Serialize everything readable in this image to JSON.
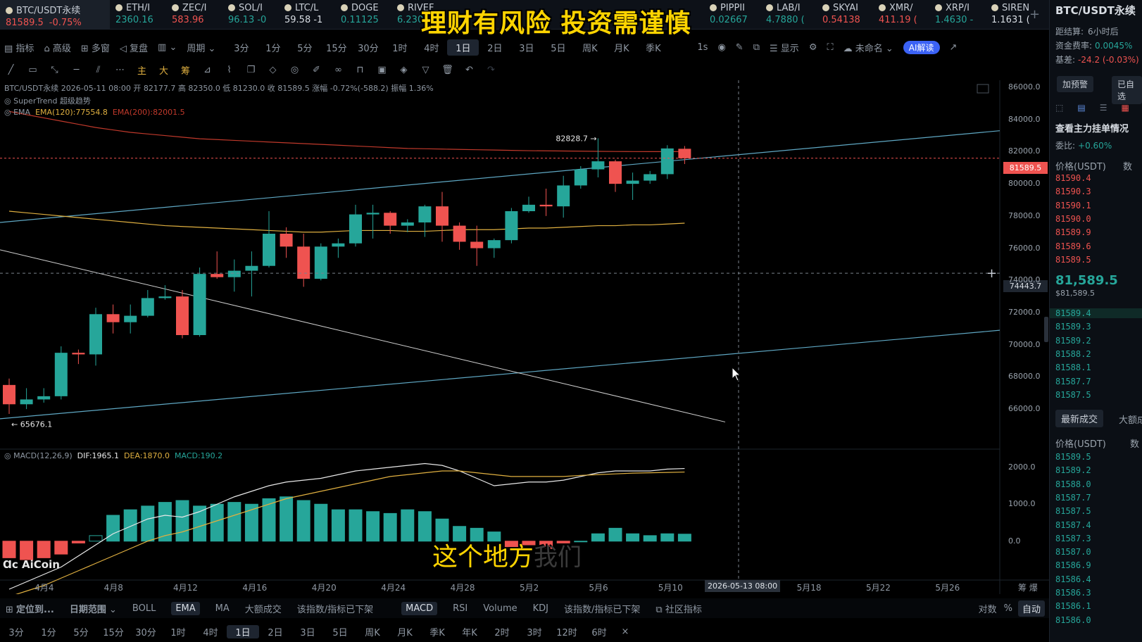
{
  "banner": "理财有风险 投资需谨慎",
  "tickers": [
    {
      "name": "BTC/USDT永续",
      "price": "81589.5",
      "change": "-0.75%",
      "dir": "dn"
    },
    {
      "name": "ETH/I",
      "price": "2360.16",
      "change": "",
      "dir": "up"
    },
    {
      "name": "ZEC/I",
      "price": "583.96",
      "change": "",
      "dir": "dn"
    },
    {
      "name": "SOL/I",
      "price": "96.13 -0",
      "change": "",
      "dir": "up"
    },
    {
      "name": "LTC/L",
      "price": "59.58 -1",
      "change": "",
      "dir": "wt"
    },
    {
      "name": "DOGE",
      "price": "0.11125",
      "change": "",
      "dir": "up"
    },
    {
      "name": "RIVEF",
      "price": "6.230 -0",
      "change": "",
      "dir": "up"
    },
    {
      "name": "PIPPII",
      "price": "0.02667",
      "change": "",
      "dir": "up"
    },
    {
      "name": "LAB/I",
      "price": "4.7880 (",
      "change": "",
      "dir": "up"
    },
    {
      "name": "SKYAI",
      "price": "0.54138",
      "change": "",
      "dir": "dn"
    },
    {
      "name": "XMR/",
      "price": "411.19 (",
      "change": "",
      "dir": "dn"
    },
    {
      "name": "XRP/I",
      "price": "1.4630 -",
      "change": "",
      "dir": "up"
    },
    {
      "name": "SIREN",
      "price": "1.1631 (",
      "change": "",
      "dir": "wt"
    }
  ],
  "toolbar": {
    "indicators": "指标",
    "advanced": "高级",
    "multiwindow": "多窗",
    "replay": "复盘",
    "period_label": "周期",
    "periods": [
      "3分",
      "1分",
      "5分",
      "15分",
      "30分",
      "1时",
      "4时",
      "1日",
      "2日",
      "3日",
      "5日",
      "周K",
      "月K",
      "季K"
    ],
    "selected_period": "1日",
    "interval": "1s",
    "display": "显示",
    "unnamed": "未命名",
    "ai": "AI解读"
  },
  "drawtools": [
    "主",
    "大",
    "筹"
  ],
  "info": {
    "line1": "BTC/USDT永续 2026-05-11 08:00 开 82177.7 高 82350.0 低 81230.0 收 81589.5 涨幅 -0.72%(-588.2) 振幅 1.36%",
    "supertrend": "SuperTrend 超级趋势",
    "ema_label": "EMA",
    "ema120": "EMA(120):77554.8",
    "ema200": "EMA(200):82001.5"
  },
  "macd_info": {
    "label": "MACD(12,26,9)",
    "dif": "DIF:1965.1",
    "dea": "DEA:1870.0",
    "macd": "MACD:190.2"
  },
  "price_axis": [
    "86000.0",
    "84000.0",
    "82000.0",
    "80000.0",
    "78000.0",
    "76000.0",
    "74000.0",
    "72000.0",
    "70000.0",
    "68000.0",
    "66000.0"
  ],
  "macd_axis": [
    "2000.0",
    "1000.0",
    "0.0"
  ],
  "current_price": "81589.5",
  "crosshair_price": "74443.7",
  "crosshair_date": "2026-05-13 08:00",
  "high_mark": "82828.7 →",
  "low_mark": "← 65676.1",
  "date_axis": [
    "4月4",
    "4月8",
    "4月12",
    "4月16",
    "4月20",
    "4月24",
    "4月28",
    "5月2",
    "5月6",
    "5月10",
    "5月18",
    "5月22",
    "5月26"
  ],
  "date_axis_right": "筹 爆",
  "bottom_indicators": {
    "locate": "定位到...",
    "date_range": "日期范围",
    "items": [
      "BOLL",
      "EMA",
      "MA",
      "大额成交",
      "该指数/指标已下架"
    ],
    "active_main": "EMA",
    "sub_items": [
      "MACD",
      "RSI",
      "Volume",
      "KDJ",
      "该指数/指标已下架"
    ],
    "active_sub": "MACD",
    "community": "社区指标",
    "log": "对数",
    "pct": "%",
    "auto": "自动"
  },
  "bottom_periods": [
    "3分",
    "1分",
    "5分",
    "15分",
    "30分",
    "1时",
    "4时",
    "1日",
    "2日",
    "3日",
    "5日",
    "周K",
    "月K",
    "季K",
    "年K",
    "2时",
    "3时",
    "12时",
    "6时",
    "×"
  ],
  "bottom_selected": "1日",
  "subtitle": "这个地方",
  "subtitle_ghost": "我们",
  "watermark": "AiCoin",
  "right_panel": {
    "title": "BTC/USDT永续",
    "settle_label": "距结算:",
    "settle": "6小时后",
    "funding_label": "资金费率:",
    "funding": "0.0045%",
    "basis_label": "基差:",
    "basis": "-24.2 (-0.03%)",
    "alert_btn": "加预警",
    "watch_btn": "已自选",
    "orders_title": "查看主力挂单情况",
    "ratio_label": "委比:",
    "ratio": "+0.60%",
    "price_col": "价格(USDT)",
    "qty_col": "数",
    "asks": [
      "81590.4",
      "81590.3",
      "81590.1",
      "81590.0",
      "81589.9",
      "81589.6",
      "81589.5"
    ],
    "mid": "81,589.5",
    "mid_sub": "$81,589.5",
    "bids": [
      "81589.4",
      "81589.3",
      "81589.2",
      "81588.2",
      "81588.1",
      "81587.7",
      "81587.5"
    ],
    "trades_tab": "最新成交",
    "big_tab": "大额成",
    "trades": [
      "81589.5",
      "81589.2",
      "81588.0",
      "81587.7",
      "81587.5",
      "81587.4",
      "81587.3",
      "81587.0",
      "81586.9",
      "81586.4",
      "81586.3",
      "81586.1",
      "81586.0"
    ]
  },
  "colors": {
    "up": "#26a69a",
    "down": "#ef5350",
    "ema120": "#e0b040",
    "ema200": "#c0392b",
    "bg": "#000000"
  },
  "chart_data": {
    "type": "candlestick",
    "x": [
      "4月2",
      "4月3",
      "4月4",
      "4月5",
      "4月6",
      "4月7",
      "4月8",
      "4月9",
      "4月10",
      "4月11",
      "4月12",
      "4月13",
      "4月14",
      "4月15",
      "4月16",
      "4月17",
      "4月18",
      "4月19",
      "4月20",
      "4月21",
      "4月22",
      "4月23",
      "4月24",
      "4月25",
      "4月26",
      "4月27",
      "4月28",
      "4月29",
      "4月30",
      "5月1",
      "5月2",
      "5月3",
      "5月4",
      "5月5",
      "5月6",
      "5月7",
      "5月8",
      "5月9",
      "5月10",
      "5月11"
    ],
    "ohlc": [
      [
        67500,
        67900,
        65700,
        66300
      ],
      [
        66300,
        67300,
        66000,
        66600
      ],
      [
        66600,
        67300,
        66400,
        66800
      ],
      [
        66800,
        69900,
        66600,
        69500
      ],
      [
        69500,
        69700,
        68800,
        69400
      ],
      [
        69400,
        72300,
        68700,
        71900
      ],
      [
        71900,
        72500,
        70700,
        71400
      ],
      [
        71400,
        72500,
        70700,
        71800
      ],
      [
        71800,
        73400,
        71700,
        72900
      ],
      [
        72900,
        73700,
        72800,
        73000
      ],
      [
        73000,
        73400,
        70400,
        70600
      ],
      [
        70600,
        74800,
        70500,
        74400
      ],
      [
        74400,
        75800,
        74100,
        74200
      ],
      [
        74200,
        75300,
        73300,
        74600
      ],
      [
        74600,
        75800,
        73000,
        74900
      ],
      [
        74900,
        78300,
        74800,
        76900
      ],
      [
        76900,
        77300,
        75400,
        76100
      ],
      [
        76100,
        76900,
        73600,
        74100
      ],
      [
        74100,
        76300,
        74000,
        76100
      ],
      [
        76100,
        76600,
        75400,
        76300
      ],
      [
        76300,
        78700,
        76100,
        78100
      ],
      [
        78100,
        78700,
        76600,
        78200
      ],
      [
        78200,
        78300,
        76900,
        77400
      ],
      [
        77400,
        77800,
        77000,
        77600
      ],
      [
        77600,
        78700,
        76700,
        78600
      ],
      [
        78600,
        79500,
        76400,
        77400
      ],
      [
        77400,
        77600,
        75900,
        76400
      ],
      [
        76400,
        77400,
        74900,
        76000
      ],
      [
        76000,
        76600,
        75400,
        76500
      ],
      [
        76500,
        78500,
        76300,
        78300
      ],
      [
        78300,
        79200,
        78200,
        78700
      ],
      [
        78700,
        79700,
        78000,
        78600
      ],
      [
        78600,
        80500,
        77900,
        79900
      ],
      [
        79900,
        81100,
        79700,
        80900
      ],
      [
        80900,
        82829,
        80400,
        81400
      ],
      [
        81400,
        81500,
        79500,
        80000
      ],
      [
        80000,
        80700,
        79000,
        80200
      ],
      [
        80200,
        80800,
        80000,
        80600
      ],
      [
        80600,
        82400,
        80300,
        82200
      ],
      [
        82178,
        82350,
        81230,
        81590
      ]
    ],
    "ema120": [
      78300,
      78200,
      78100,
      78000,
      77900,
      77800,
      77700,
      77600,
      77500,
      77400,
      77350,
      77300,
      77250,
      77200,
      77150,
      77100,
      77050,
      77000,
      77000,
      77050,
      77100,
      77100,
      77100,
      77050,
      77050,
      77100,
      77150,
      77150,
      77150,
      77200,
      77250,
      77250,
      77300,
      77350,
      77400,
      77400,
      77450,
      77450,
      77500,
      77555
    ],
    "ema200": [
      84500,
      84300,
      84100,
      83900,
      83700,
      83500,
      83350,
      83200,
      83100,
      83000,
      82900,
      82800,
      82750,
      82700,
      82650,
      82600,
      82550,
      82500,
      82450,
      82400,
      82350,
      82300,
      82250,
      82200,
      82180,
      82160,
      82140,
      82120,
      82100,
      82080,
      82060,
      82050,
      82040,
      82030,
      82020,
      82010,
      82005,
      82003,
      82002,
      82001.5
    ],
    "macd_dif": [
      -1300,
      -1100,
      -900,
      -700,
      -400,
      -100,
      200,
      400,
      600,
      700,
      650,
      800,
      1000,
      1200,
      1350,
      1500,
      1600,
      1650,
      1700,
      1800,
      1900,
      1950,
      2000,
      2050,
      2100,
      2050,
      1900,
      1700,
      1500,
      1550,
      1600,
      1600,
      1650,
      1750,
      1850,
      1900,
      1900,
      1900,
      1950,
      1965
    ],
    "macd_dea": [
      -1500,
      -1350,
      -1200,
      -1000,
      -800,
      -600,
      -400,
      -200,
      0,
      150,
      250,
      400,
      550,
      700,
      850,
      1000,
      1150,
      1250,
      1350,
      1450,
      1550,
      1650,
      1750,
      1800,
      1850,
      1900,
      1900,
      1850,
      1800,
      1750,
      1750,
      1750,
      1750,
      1780,
      1800,
      1820,
      1840,
      1850,
      1860,
      1870
    ],
    "macd_hist": [
      -450,
      -500,
      -450,
      -350,
      -50,
      150,
      700,
      850,
      950,
      1050,
      1100,
      950,
      1000,
      1050,
      1000,
      1150,
      1200,
      1100,
      1000,
      850,
      850,
      800,
      750,
      850,
      800,
      600,
      400,
      350,
      250,
      -150,
      -100,
      -200,
      -50,
      0,
      200,
      350,
      200,
      150,
      200,
      190
    ],
    "ylim": [
      65000,
      86000
    ],
    "macd_ylim": [
      -900,
      2300
    ]
  }
}
